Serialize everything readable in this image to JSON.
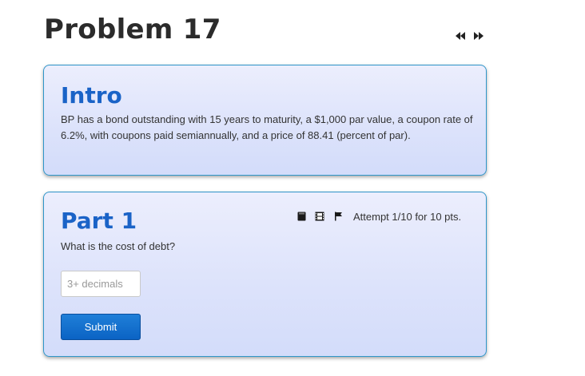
{
  "header": {
    "title": "Problem 17",
    "nav": [
      {
        "icon": "previous-icon"
      },
      {
        "icon": "next-icon"
      }
    ]
  },
  "intro": {
    "heading": "Intro",
    "text": "BP has a bond outstanding with 15 years to maturity, a $1,000 par value, a coupon rate of 6.2%, with coupons paid semiannually, and a price of 88.41 (percent of par)."
  },
  "part1": {
    "heading": "Part 1",
    "tools": [
      "book-icon",
      "film-icon",
      "flag-icon"
    ],
    "attempt": "Attempt 1/10 for 10 pts.",
    "question": "What is the cost of debt?",
    "input": {
      "placeholder": "3+ decimals",
      "value": ""
    },
    "submit_label": "Submit"
  },
  "colors": {
    "heading": "#1a63c7",
    "card_border": "#2f96c9",
    "card_bg_top": "#eceefd",
    "card_bg_bottom": "#d3dcfa",
    "button": "#0b63c4"
  }
}
